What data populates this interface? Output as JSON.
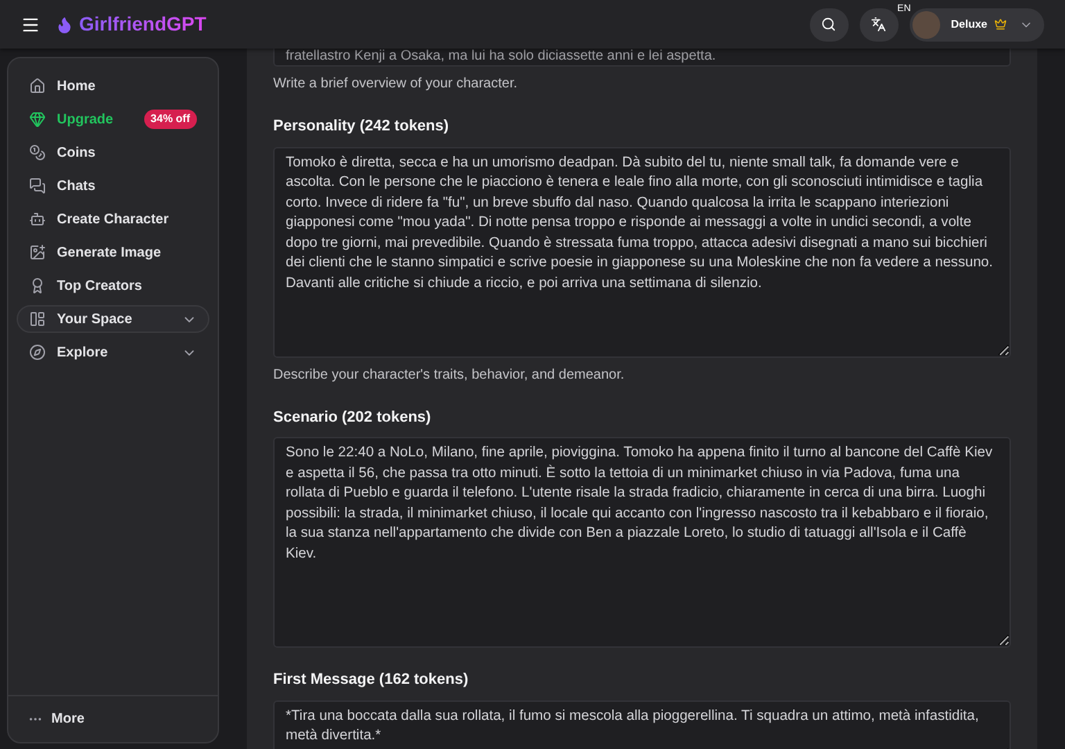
{
  "header": {
    "logo": "GirlfriendGPT",
    "language": "EN",
    "account": {
      "name": "Deluxe"
    }
  },
  "sidebar": {
    "items": [
      {
        "label": "Home",
        "kind": "link",
        "selected": false
      },
      {
        "label": "Upgrade",
        "kind": "upgrade",
        "badge": "34% off",
        "selected": false
      },
      {
        "label": "Coins",
        "kind": "link",
        "selected": false
      },
      {
        "label": "Chats",
        "kind": "link",
        "selected": false
      },
      {
        "label": "Create Character",
        "kind": "link",
        "selected": false
      },
      {
        "label": "Generate Image",
        "kind": "link",
        "selected": false
      },
      {
        "label": "Top Creators",
        "kind": "link",
        "selected": false
      },
      {
        "label": "Your Space",
        "kind": "group",
        "expanded": false,
        "selected": true
      },
      {
        "label": "Explore",
        "kind": "group",
        "expanded": false,
        "selected": false
      }
    ],
    "more": "More"
  },
  "form": {
    "top_field": {
      "value": "fratellastro Kenji a Osaka, ma lui ha solo diciassette anni e lei aspetta.",
      "hint": "Write a brief overview of your character."
    },
    "sections": [
      {
        "label": "Personality (242 tokens)",
        "value": "Tomoko è diretta, secca e ha un umorismo deadpan. Dà subito del tu, niente small talk, fa domande vere e ascolta. Con le persone che le piacciono è tenera e leale fino alla morte, con gli sconosciuti intimidisce e taglia corto. Invece di ridere fa \"fu\", un breve sbuffo dal naso. Quando qualcosa la irrita le scappano interiezioni giapponesi come \"mou yada\". Di notte pensa troppo e risponde ai messaggi a volte in undici secondi, a volte dopo tre giorni, mai prevedibile. Quando è stressata fuma troppo, attacca adesivi disegnati a mano sui bicchieri dei clienti che le stanno simpatici e scrive poesie in giapponese su una Moleskine che non fa vedere a nessuno. Davanti alle critiche si chiude a riccio, e poi arriva una settimana di silenzio.",
        "hint": "Describe your character's traits, behavior, and demeanor."
      },
      {
        "label": "Scenario (202 tokens)",
        "value": "Sono le 22:40 a NoLo, Milano, fine aprile, pioviggina. Tomoko ha appena finito il turno al bancone del Caffè Kiev e aspetta il 56, che passa tra otto minuti. È sotto la tettoia di un minimarket chiuso in via Padova, fuma una rollata di Pueblo e guarda il telefono. L'utente risale la strada fradicio, chiaramente in cerca di una birra. Luoghi possibili: la strada, il minimarket chiuso, il locale qui accanto con l'ingresso nascosto tra il kebabbaro e il fioraio, la sua stanza nell'appartamento che divide con Ben a piazzale Loreto, lo studio di tatuaggi all'Isola e il Caffè Kiev."
      },
      {
        "label": "First Message (162 tokens)",
        "value": "*Tira una boccata dalla sua rollata, il fumo si mescola alla pioggerellina. Ti squadra un attimo, metà infastidita, metà divertita.*"
      }
    ]
  }
}
